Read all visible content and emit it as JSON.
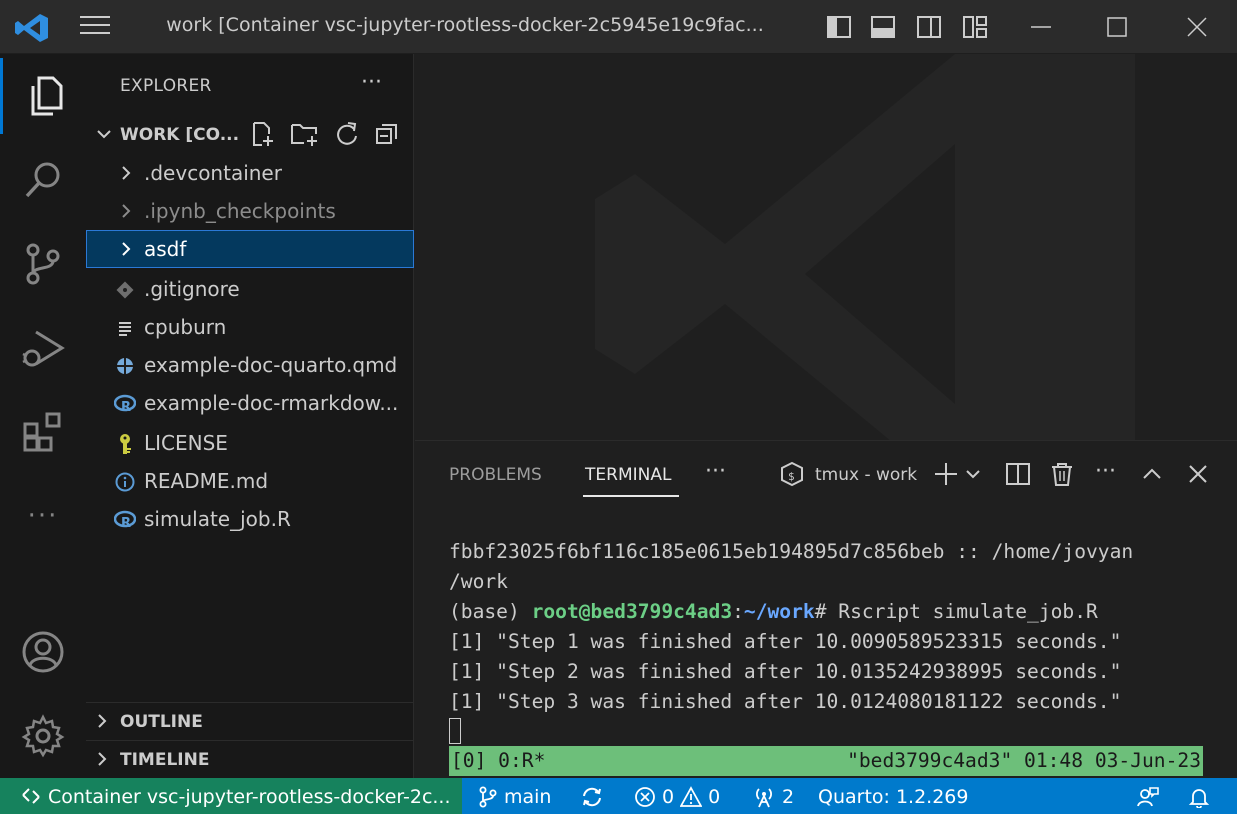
{
  "titlebar": {
    "title": "work [Container vsc-jupyter-rootless-docker-2c5945e19c9fac..."
  },
  "explorer": {
    "header": "EXPLORER",
    "more": "···",
    "section_label": "WORK [CO...",
    "items": [
      {
        "name": ".devcontainer",
        "kind": "folder"
      },
      {
        "name": ".ipynb_checkpoints",
        "kind": "folder"
      },
      {
        "name": "asdf",
        "kind": "folder"
      },
      {
        "name": ".gitignore",
        "kind": "git-file"
      },
      {
        "name": "cpuburn",
        "kind": "text-file"
      },
      {
        "name": "example-doc-quarto.qmd",
        "kind": "quarto-file"
      },
      {
        "name": "example-doc-rmarkdow...",
        "kind": "r-file"
      },
      {
        "name": "LICENSE",
        "kind": "license-file"
      },
      {
        "name": "README.md",
        "kind": "info-file"
      },
      {
        "name": "simulate_job.R",
        "kind": "r-file"
      }
    ],
    "outline": "OUTLINE",
    "timeline": "TIMELINE"
  },
  "panel": {
    "tabs": [
      "PROBLEMS",
      "TERMINAL"
    ],
    "more": "···",
    "terminal_name": "tmux - work"
  },
  "terminal": {
    "line1": "fbbf23025f6bf116c185e0615eb194895d7c856beb :: /home/jovyan",
    "line2": "/work",
    "prompt_base": "(base) ",
    "prompt_user": "root@bed3799c4ad3",
    "prompt_colon": ":",
    "prompt_path": "~/work",
    "prompt_cmd": "# Rscript simulate_job.R",
    "out1": "[1] \"Step 1 was finished after 10.0090589523315 seconds.\"",
    "out2": "[1] \"Step 2 was finished after 10.0135242938995 seconds.\"",
    "out3": "[1] \"Step 3 was finished after 10.0124080181122 seconds.\"",
    "tmux_left": "[0] 0:R*",
    "tmux_right": "\"bed3799c4ad3\" 01:48 03-Jun-23"
  },
  "statusbar": {
    "remote": "Container vsc-jupyter-rootless-docker-2c...",
    "branch": "main",
    "errors": "0",
    "warnings": "0",
    "ports": "2",
    "quarto": "Quarto: 1.2.269"
  },
  "colors": {
    "accent": "#0078d4",
    "statusbar": "#007acc",
    "remote": "#16825d",
    "tmux": "#6dbf7a"
  }
}
